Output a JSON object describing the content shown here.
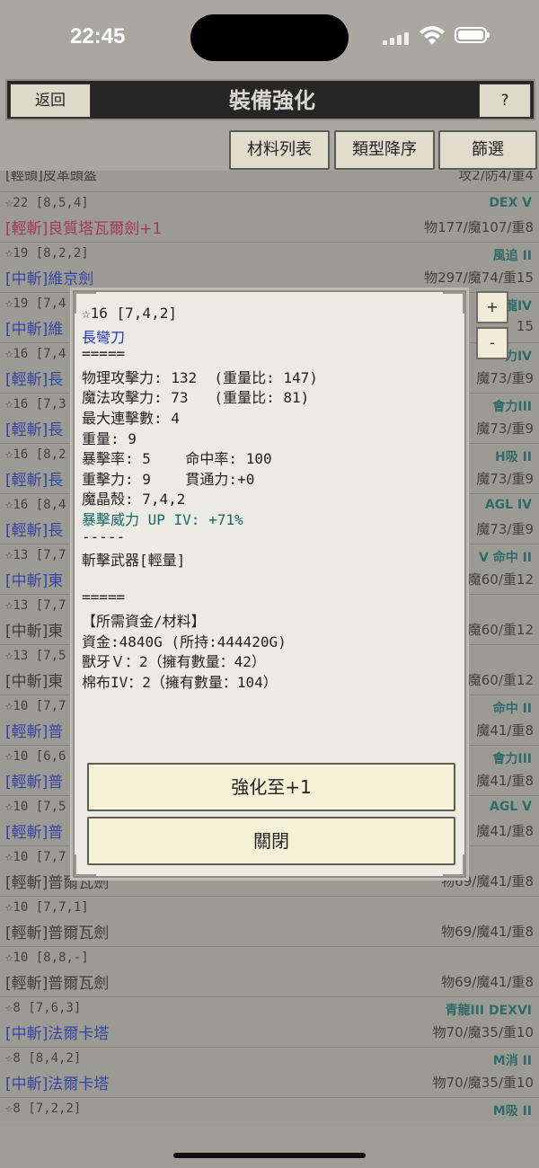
{
  "status": {
    "time": "22:45"
  },
  "header": {
    "back_label": "返回",
    "title": "裝備強化",
    "help_label": "?"
  },
  "toolbar": {
    "materials": "材料列表",
    "sort": "類型降序",
    "filter": "篩選"
  },
  "list": [
    {
      "meta": "",
      "tag": "",
      "name": "[輕頭]皮革頭盔",
      "name_color": "dark",
      "stats": "攻2/防4/重4"
    },
    {
      "meta": "☆22 [8,5,4]",
      "tag": "DEX V",
      "name": "[輕斬]良質塔瓦爾劍+1",
      "name_color": "pink",
      "stats": "物177/魔107/重8"
    },
    {
      "meta": "☆19 [8,2,2]",
      "tag": "風追 II",
      "name": "[中斬]維京劍",
      "name_color": "blue",
      "stats": "物297/魔74/重15"
    },
    {
      "meta": "☆19 [7,4",
      "tag": "龍IV",
      "name": "[中斬]維",
      "name_color": "blue",
      "stats": "15"
    },
    {
      "meta": "☆16 [7,4",
      "tag": "力IV",
      "name": "[輕斬]長",
      "name_color": "blue",
      "stats": "魔73/重9"
    },
    {
      "meta": "☆16 [7,3",
      "tag": "會力III",
      "name": "[輕斬]長",
      "name_color": "blue",
      "stats": "魔73/重9"
    },
    {
      "meta": "☆16 [8,2",
      "tag": "H吸 II",
      "name": "[輕斬]長",
      "name_color": "blue",
      "stats": "魔73/重9"
    },
    {
      "meta": "☆16 [8,4",
      "tag": "AGL IV",
      "name": "[輕斬]長",
      "name_color": "blue",
      "stats": "魔73/重9"
    },
    {
      "meta": "☆13 [7,7",
      "tag": "V 命中 II",
      "name": "[中斬]東",
      "name_color": "blue",
      "stats": "魔60/重12"
    },
    {
      "meta": "☆13 [7,7",
      "tag": "",
      "name": "[中斬]東",
      "name_color": "dark",
      "stats": "魔60/重12"
    },
    {
      "meta": "☆13 [7,5",
      "tag": "",
      "name": "[中斬]東",
      "name_color": "dark",
      "stats": "魔60/重12"
    },
    {
      "meta": "☆10 [7,7",
      "tag": "命中 II",
      "name": "[輕斬]普",
      "name_color": "blue",
      "stats": "魔41/重8"
    },
    {
      "meta": "☆10 [6,6",
      "tag": "會力III",
      "name": "[輕斬]普",
      "name_color": "blue",
      "stats": "魔41/重8"
    },
    {
      "meta": "☆10 [7,5",
      "tag": "AGL V",
      "name": "[輕斬]普",
      "name_color": "blue",
      "stats": "魔41/重8"
    },
    {
      "meta": "☆10 [7,7",
      "tag": "",
      "name": "[輕斬]普爾瓦劍",
      "name_color": "dark",
      "stats": "物69/魔41/重8"
    },
    {
      "meta": "☆10 [7,7,1]",
      "tag": "",
      "name": "[輕斬]普爾瓦劍",
      "name_color": "dark",
      "stats": "物69/魔41/重8"
    },
    {
      "meta": "☆10 [8,8,-]",
      "tag": "",
      "name": "[輕斬]普爾瓦劍",
      "name_color": "dark",
      "stats": "物69/魔41/重8"
    },
    {
      "meta": "☆8 [7,6,3]",
      "tag": "青龍III DEXVI",
      "name": "[中斬]法爾卡塔",
      "name_color": "blue",
      "stats": "物70/魔35/重10"
    },
    {
      "meta": "☆8 [8,4,2]",
      "tag": "M消 II",
      "name": "[中斬]法爾卡塔",
      "name_color": "blue",
      "stats": "物70/魔35/重10"
    },
    {
      "meta": "☆8 [7,2,2]",
      "tag": "M吸 II",
      "name": "",
      "name_color": "blue",
      "stats": ""
    }
  ],
  "modal": {
    "lines": [
      {
        "text": "☆16 [7,4,2]",
        "color": "#222222"
      },
      {
        "text": "長彎刀",
        "color": "#1f34b8"
      },
      {
        "text": "=====",
        "color": "#222222"
      },
      {
        "text": "物理攻擊力: 132  (重量比: 147)",
        "color": "#222222"
      },
      {
        "text": "魔法攻擊力: 73   (重量比: 81)",
        "color": "#222222"
      },
      {
        "text": "最大連擊數: 4",
        "color": "#222222"
      },
      {
        "text": "重量: 9",
        "color": "#222222"
      },
      {
        "text": "暴擊率: 5    命中率: 100",
        "color": "#222222"
      },
      {
        "text": "重擊力: 9    貫通力:+0",
        "color": "#222222"
      },
      {
        "text": "魔晶殼: 7,4,2",
        "color": "#222222"
      },
      {
        "text": "暴擊威力 UP IV: +71%",
        "color": "#17676a"
      },
      {
        "text": "-----",
        "color": "#222222"
      },
      {
        "text": "斬擊武器[輕量]",
        "color": "#222222"
      },
      {
        "text": "",
        "color": "#222222"
      },
      {
        "text": "=====",
        "color": "#222222"
      },
      {
        "text": "【所需資金/材料】",
        "color": "#222222"
      },
      {
        "text": "資金:4840G (所持:444420G)",
        "color": "#222222"
      },
      {
        "text": "獸牙Ｖ：2（擁有數量：42）",
        "color": "#222222"
      },
      {
        "text": "棉布IV：2（擁有數量：104）",
        "color": "#222222"
      }
    ],
    "enhance_label": "強化至+1",
    "close_label": "關閉"
  },
  "side": {
    "plus": "+",
    "minus": "-"
  },
  "colors": {
    "blue": "#1f34b8",
    "pink": "#b0205a",
    "teal": "#17676a"
  }
}
